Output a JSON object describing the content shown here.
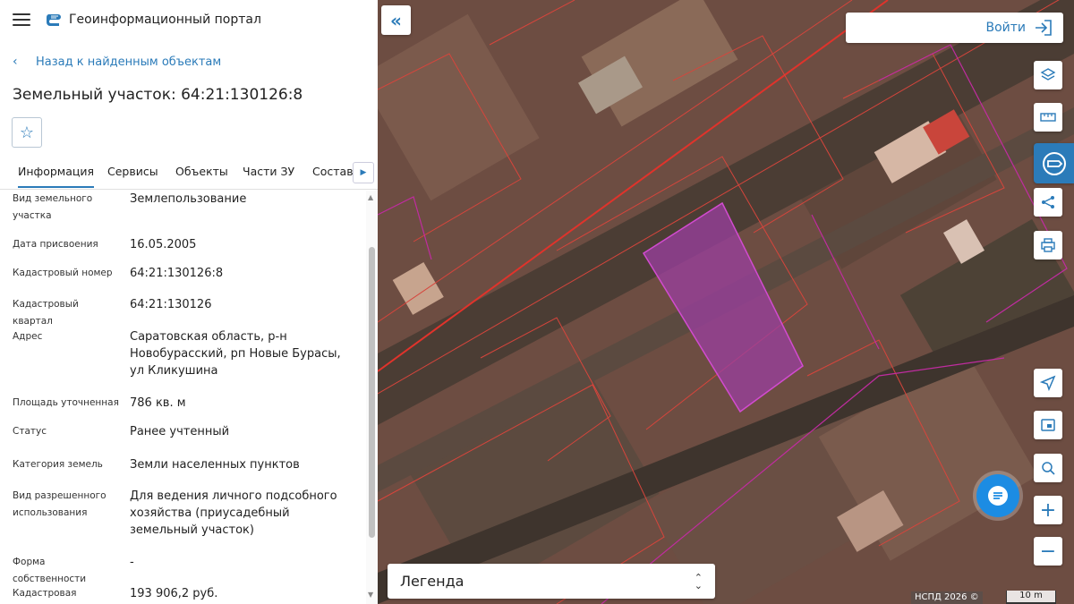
{
  "header": {
    "app_title": "Геоинформационный портал",
    "menu_icon": "hamburger-menu-icon",
    "logo_icon": "portal-logo-icon"
  },
  "navigation": {
    "back_label": "Назад к найденным объектам"
  },
  "object": {
    "title": "Земельный участок: 64:21:130126:8"
  },
  "tabs": [
    {
      "label": "Информация",
      "active": true
    },
    {
      "label": "Сервисы",
      "active": false
    },
    {
      "label": "Объекты",
      "active": false
    },
    {
      "label": "Части ЗУ",
      "active": false
    },
    {
      "label": "Состав",
      "active": false
    }
  ],
  "properties": [
    {
      "label": "Вид земельного участка",
      "value": "Землепользование"
    },
    {
      "label": "Дата присвоения",
      "value": "16.05.2005"
    },
    {
      "label": "Кадастровый номер",
      "value": "64:21:130126:8"
    },
    {
      "label": "Кадастровый квартал",
      "value": "64:21:130126"
    },
    {
      "label": "Адрес",
      "value": "Саратовская область, р-н Новобурасский, рп Новые Бурасы, ул Кликушина"
    },
    {
      "label": "Площадь уточненная",
      "value": "786 кв. м"
    },
    {
      "label": "Статус",
      "value": "Ранее учтенный"
    },
    {
      "label": "Категория земель",
      "value": "Земли населенных пунктов"
    },
    {
      "label": "Вид разрешенного использования",
      "value": "Для ведения личного подсобного хозяйства (приусадебный земельный участок)"
    },
    {
      "label": "Форма собственности",
      "value": "-"
    },
    {
      "label": "Кадастровая",
      "value": "193 906,2 руб."
    }
  ],
  "map": {
    "login_label": "Войти",
    "legend_label": "Легенда",
    "attribution": "НСПД 2026 ©",
    "scale_label": "10 m",
    "colors": {
      "accent": "#2b7bb9",
      "parcel_fill": "#9b3fa0",
      "boundary_red": "#e0332b",
      "boundary_magenta": "#c02ca0"
    }
  }
}
